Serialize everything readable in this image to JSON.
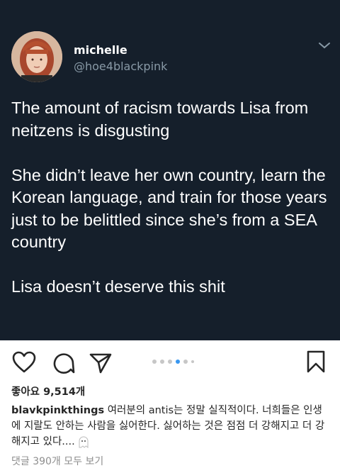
{
  "tweet": {
    "display_name": "michelle",
    "handle": "@hoe4blackpink",
    "paragraphs": [
      "The amount of racism towards Lisa from neitzens is disgusting",
      "She didn’t leave her own country, learn the Korean language, and train for those years just to be belittled since she’s from a SEA country",
      "Lisa doesn’t deserve this shit"
    ],
    "background_color": "#151f2b"
  },
  "post": {
    "icons": [
      "heart-icon",
      "comment-icon",
      "share-icon",
      "bookmark-icon"
    ],
    "carousel": {
      "count": 6,
      "active_index": 3
    },
    "likes": "좋아요 9,514개",
    "caption_user": "blavkpinkthings",
    "caption_text": "여러분의 antis는 정말 실직적이다. 너희들은 인생에 지랄도 안하는 사람을 싫어한다. 싫어하는 것은 점점 더 강해지고 더 강해지고 있다....",
    "comments_link": "댓글 390개 모두 보기",
    "accent_color": "#3897f0"
  }
}
